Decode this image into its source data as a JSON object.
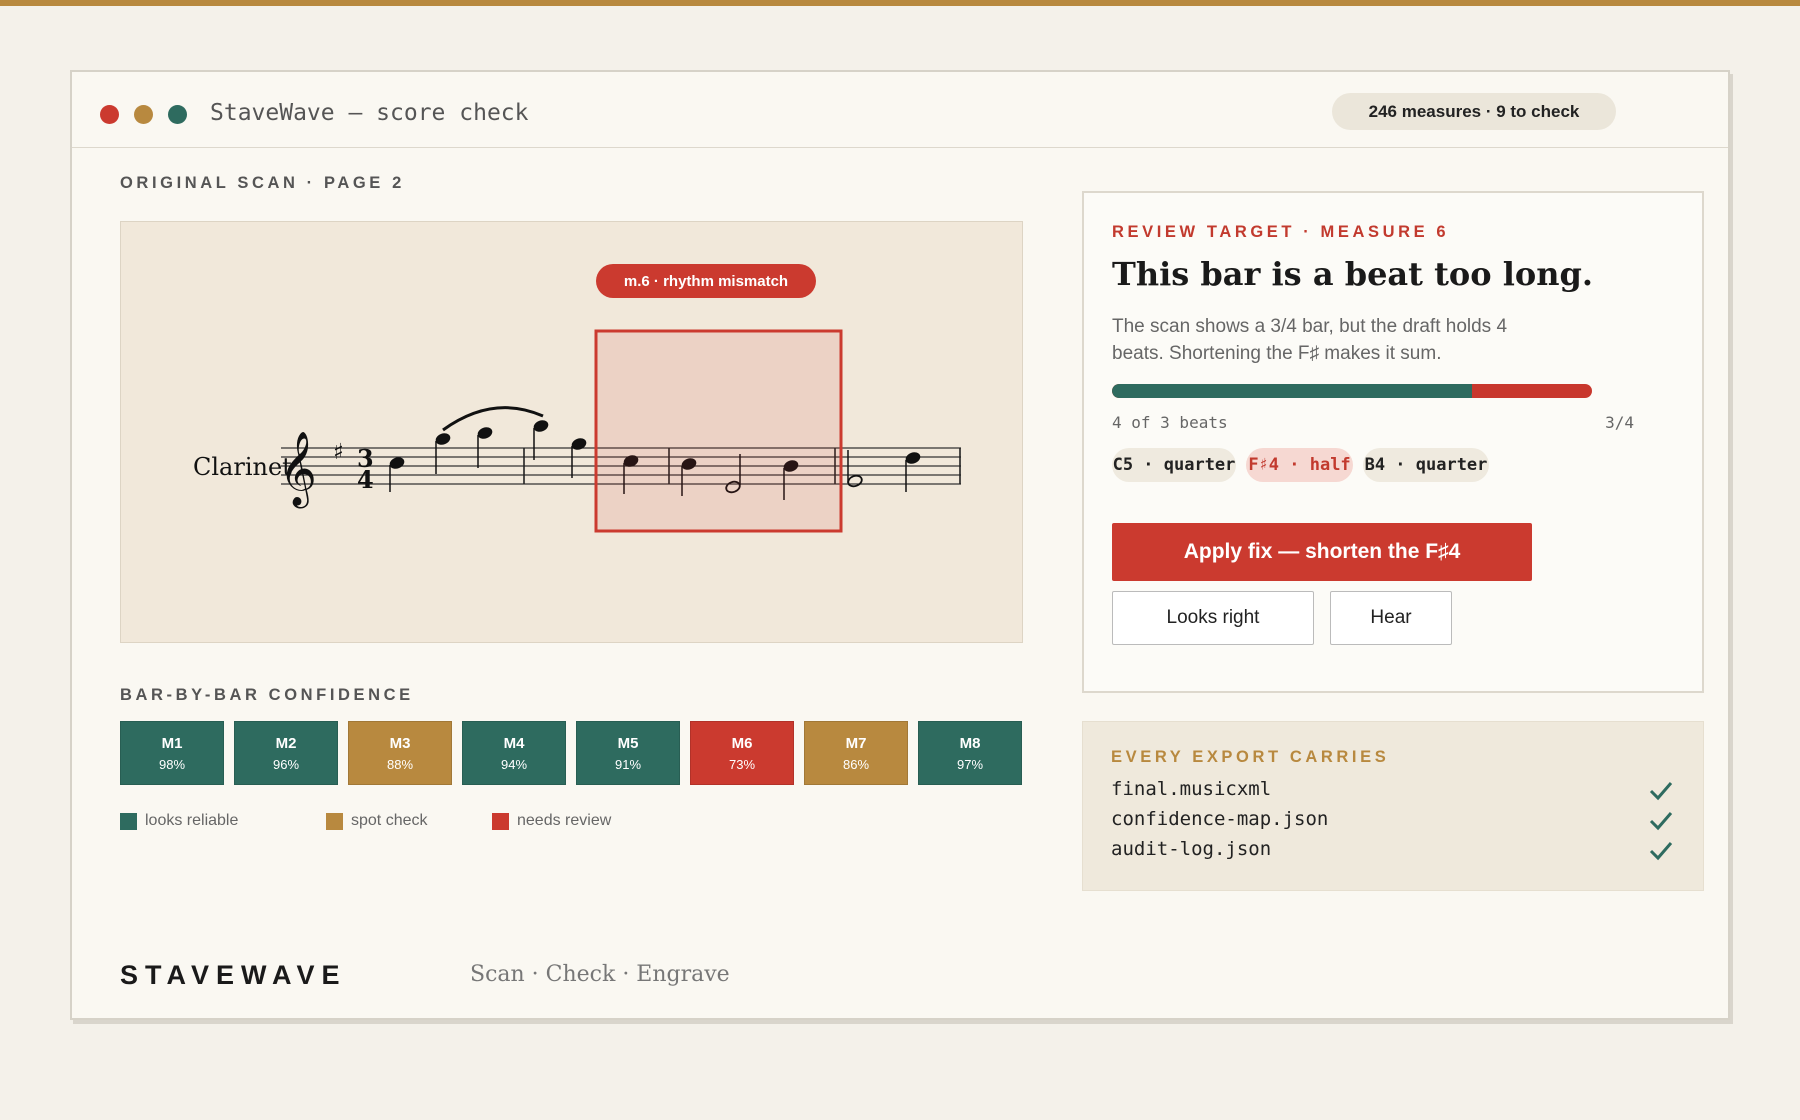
{
  "window": {
    "title": "StaveWave — score check",
    "status": "246 measures · 9 to check"
  },
  "scan": {
    "label": "ORIGINAL SCAN · PAGE 2",
    "instrument": "Clarinet",
    "time_signature": "3/4",
    "flag": "m.6 · rhythm mismatch"
  },
  "confidence": {
    "label": "BAR-BY-BAR CONFIDENCE",
    "bars": [
      {
        "measure": "M1",
        "percent": "98%",
        "status": "reliable"
      },
      {
        "measure": "M2",
        "percent": "96%",
        "status": "reliable"
      },
      {
        "measure": "M3",
        "percent": "88%",
        "status": "spot"
      },
      {
        "measure": "M4",
        "percent": "94%",
        "status": "reliable"
      },
      {
        "measure": "M5",
        "percent": "91%",
        "status": "reliable"
      },
      {
        "measure": "M6",
        "percent": "73%",
        "status": "review"
      },
      {
        "measure": "M7",
        "percent": "86%",
        "status": "spot"
      },
      {
        "measure": "M8",
        "percent": "97%",
        "status": "reliable"
      }
    ],
    "legend": {
      "reliable": "looks reliable",
      "spot": "spot check",
      "review": "needs review"
    }
  },
  "review": {
    "eyebrow": "REVIEW TARGET · MEASURE 6",
    "title": "This bar is a beat too long.",
    "body": "The scan shows a 3/4 bar, but the draft holds 4 beats. Shortening the F♯ makes it sum.",
    "beats_caption": "4 of 3 beats",
    "meter": "3/4",
    "beats_expected": 3,
    "beats_actual": 4,
    "notes": [
      {
        "label": "C5 · quarter",
        "flagged": false
      },
      {
        "label": "F♯4 · half",
        "flagged": true
      },
      {
        "label": "B4 · quarter",
        "flagged": false
      }
    ],
    "apply_label": "Apply fix — shorten the F♯4",
    "looks_right_label": "Looks right",
    "hear_label": "Hear"
  },
  "exports": {
    "eyebrow": "EVERY EXPORT CARRIES",
    "files": [
      "final.musicxml",
      "confidence-map.json",
      "audit-log.json"
    ]
  },
  "footer": {
    "brand": "STAVEWAVE",
    "tagline": "Scan · Check · Engrave"
  },
  "colors": {
    "reliable": "#2e6b5f",
    "spot": "#b8893f",
    "review": "#cb3a2f",
    "accent": "#b8893f"
  }
}
